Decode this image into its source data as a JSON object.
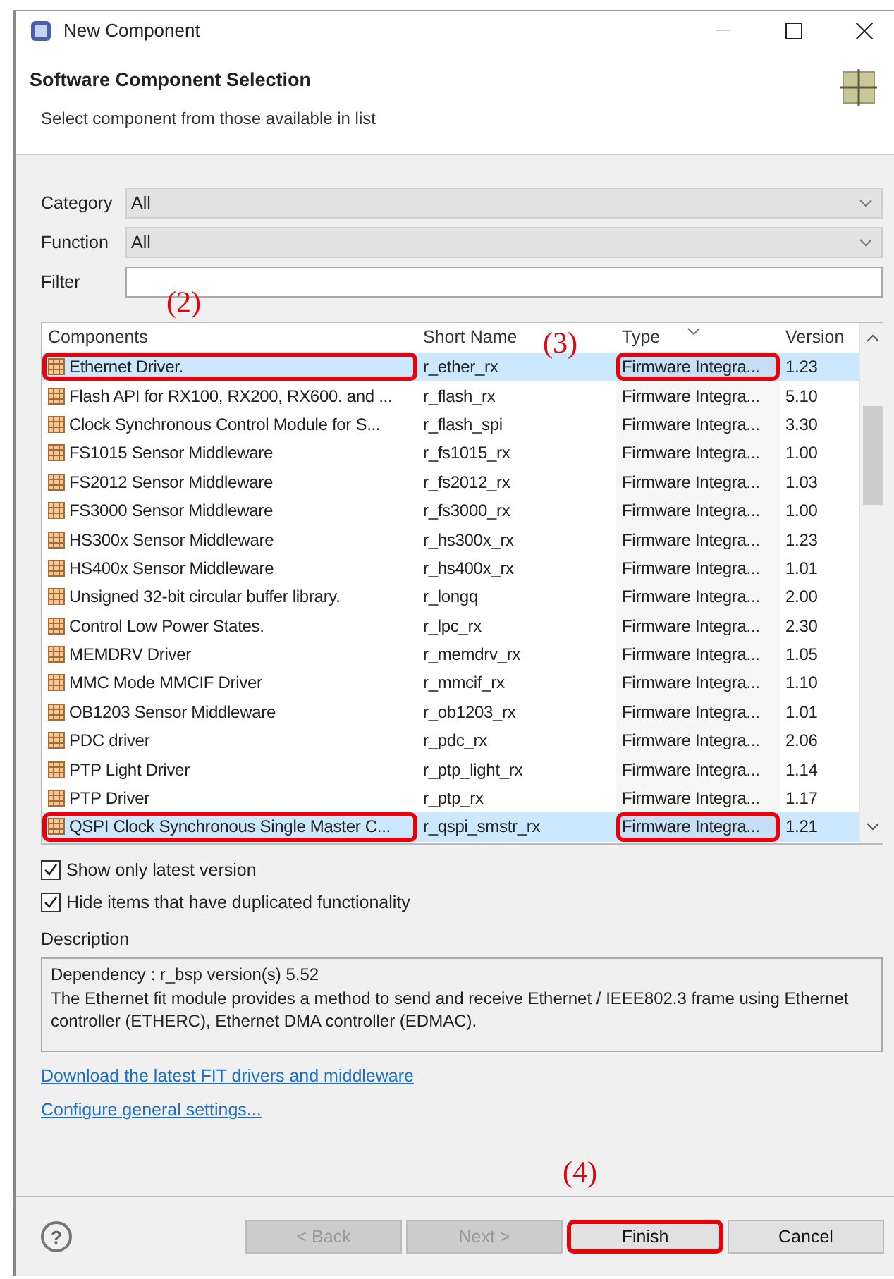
{
  "window": {
    "title": "New Component"
  },
  "header": {
    "title": "Software Component Selection",
    "subtitle": "Select component from those available in list"
  },
  "filters": [
    {
      "label": "Category",
      "kind": "dropdown",
      "value": "All"
    },
    {
      "label": "Function",
      "kind": "dropdown",
      "value": "All"
    },
    {
      "label": "Filter",
      "kind": "text"
    }
  ],
  "table": {
    "columns": [
      "Components",
      "Short Name",
      "Type",
      "Version"
    ],
    "rows": [
      {
        "component": "Ethernet Driver.",
        "short_name": "r_ether_rx",
        "type": "Firmware Integra...",
        "version": "1.23",
        "selected": true,
        "annotated": true
      },
      {
        "component": "Flash API for RX100, RX200, RX600. and ...",
        "short_name": "r_flash_rx",
        "type": "Firmware Integra...",
        "version": "5.10",
        "selected": false,
        "annotated": false
      },
      {
        "component": "Clock Synchronous Control Module for S...",
        "short_name": "r_flash_spi",
        "type": "Firmware Integra...",
        "version": "3.30",
        "selected": false,
        "annotated": false
      },
      {
        "component": "FS1015 Sensor Middleware",
        "short_name": "r_fs1015_rx",
        "type": "Firmware Integra...",
        "version": "1.00",
        "selected": false,
        "annotated": false
      },
      {
        "component": "FS2012 Sensor Middleware",
        "short_name": "r_fs2012_rx",
        "type": "Firmware Integra...",
        "version": "1.03",
        "selected": false,
        "annotated": false
      },
      {
        "component": "FS3000 Sensor Middleware",
        "short_name": "r_fs3000_rx",
        "type": "Firmware Integra...",
        "version": "1.00",
        "selected": false,
        "annotated": false
      },
      {
        "component": "HS300x Sensor Middleware",
        "short_name": "r_hs300x_rx",
        "type": "Firmware Integra...",
        "version": "1.23",
        "selected": false,
        "annotated": false
      },
      {
        "component": "HS400x Sensor Middleware",
        "short_name": "r_hs400x_rx",
        "type": "Firmware Integra...",
        "version": "1.01",
        "selected": false,
        "annotated": false
      },
      {
        "component": "Unsigned 32-bit circular buffer library.",
        "short_name": "r_longq",
        "type": "Firmware Integra...",
        "version": "2.00",
        "selected": false,
        "annotated": false
      },
      {
        "component": "Control Low Power States.",
        "short_name": "r_lpc_rx",
        "type": "Firmware Integra...",
        "version": "2.30",
        "selected": false,
        "annotated": false
      },
      {
        "component": "MEMDRV Driver",
        "short_name": "r_memdrv_rx",
        "type": "Firmware Integra...",
        "version": "1.05",
        "selected": false,
        "annotated": false
      },
      {
        "component": "MMC Mode MMCIF Driver",
        "short_name": "r_mmcif_rx",
        "type": "Firmware Integra...",
        "version": "1.10",
        "selected": false,
        "annotated": false
      },
      {
        "component": "OB1203 Sensor Middleware",
        "short_name": "r_ob1203_rx",
        "type": "Firmware Integra...",
        "version": "1.01",
        "selected": false,
        "annotated": false
      },
      {
        "component": "PDC driver",
        "short_name": "r_pdc_rx",
        "type": "Firmware Integra...",
        "version": "2.06",
        "selected": false,
        "annotated": false
      },
      {
        "component": "PTP Light Driver",
        "short_name": "r_ptp_light_rx",
        "type": "Firmware Integra...",
        "version": "1.14",
        "selected": false,
        "annotated": false
      },
      {
        "component": "PTP Driver",
        "short_name": "r_ptp_rx",
        "type": "Firmware Integra...",
        "version": "1.17",
        "selected": false,
        "annotated": false
      },
      {
        "component": "QSPI Clock Synchronous Single Master C...",
        "short_name": "r_qspi_smstr_rx",
        "type": "Firmware Integra...",
        "version": "1.21",
        "selected": true,
        "annotated": true
      }
    ]
  },
  "options": [
    {
      "label": "Show only latest version",
      "checked": true
    },
    {
      "label": "Hide items that have duplicated functionality",
      "checked": true
    }
  ],
  "description": {
    "label": "Description",
    "lines": [
      "Dependency : r_bsp version(s) 5.52",
      "The Ethernet fit module provides a method to send and receive Ethernet / IEEE802.3 frame using Ethernet controller (ETHERC), Ethernet DMA controller (EDMAC)."
    ]
  },
  "links": [
    "Download the latest FIT drivers and middleware",
    "Configure general settings..."
  ],
  "annotations": {
    "components": "(2)",
    "type": "(3)",
    "finish": "(4)"
  },
  "footer": {
    "help": "?",
    "buttons": [
      {
        "label": "< Back",
        "disabled": true,
        "annotated": false
      },
      {
        "label": "Next >",
        "disabled": true,
        "annotated": false
      },
      {
        "label": "Finish",
        "disabled": false,
        "annotated": true
      },
      {
        "label": "Cancel",
        "disabled": false,
        "annotated": false
      }
    ]
  }
}
